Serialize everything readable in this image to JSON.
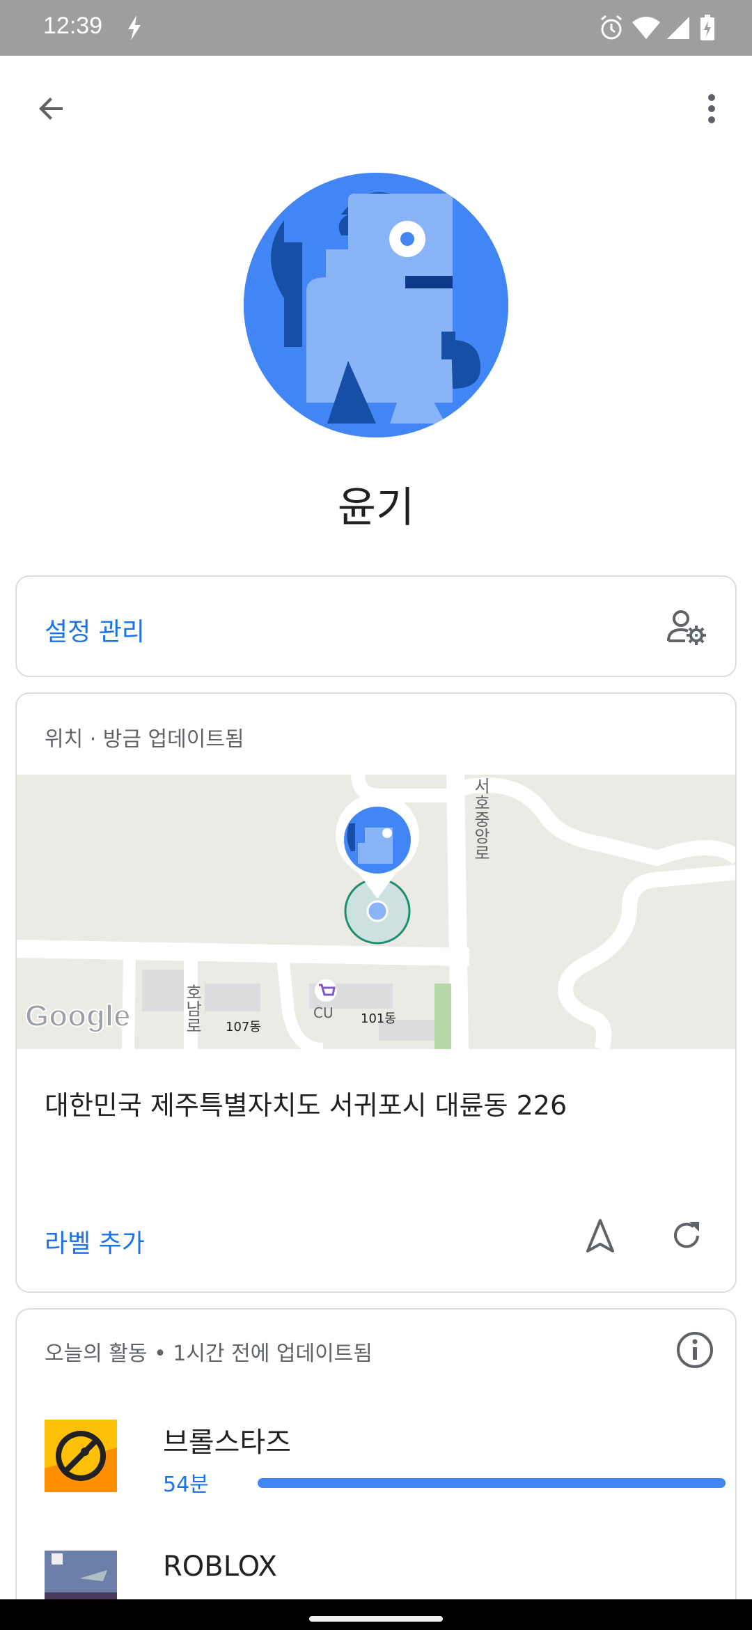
{
  "status_bar": {
    "time": "12:39"
  },
  "app_bar": {
    "back_icon": "arrow-back-icon",
    "menu_icon": "more-vert-icon"
  },
  "profile": {
    "name": "윤기",
    "avatar_icon": "dog-avatar-icon"
  },
  "settings": {
    "label": "설정 관리",
    "icon": "manage-account-icon"
  },
  "location": {
    "header": "위치 · 방금 업데이트됨",
    "address": "대한민국 제주특별자치도 서귀포시 대륜동 226",
    "add_label": "라벨 추가",
    "map": {
      "road_label": "서호중앙로",
      "road_label_2": "호남로",
      "building_1": "107동",
      "building_2": "101동",
      "store": "CU",
      "logo": "Google"
    }
  },
  "activity": {
    "header": "오늘의 활동 • 1시간 전에 업데이트됨",
    "apps": [
      {
        "name": "브롤스타즈",
        "time": "54분",
        "usage_fraction": 1.0
      },
      {
        "name": "ROBLOX",
        "time": "",
        "usage_fraction": 0
      }
    ]
  },
  "colors": {
    "accent": "#1a73e8",
    "avatar_bg": "#4285f4",
    "bar": "#4285f4",
    "status_bar": "#9e9e9e"
  }
}
